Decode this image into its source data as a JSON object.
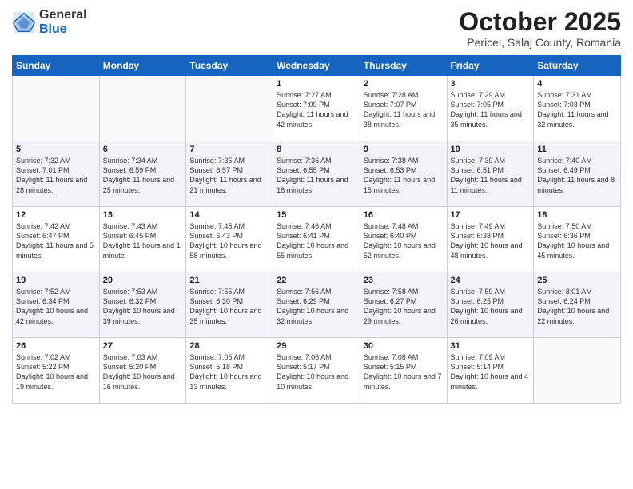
{
  "header": {
    "logo_general": "General",
    "logo_blue": "Blue",
    "month_title": "October 2025",
    "location": "Pericei, Salaj County, Romania"
  },
  "weekdays": [
    "Sunday",
    "Monday",
    "Tuesday",
    "Wednesday",
    "Thursday",
    "Friday",
    "Saturday"
  ],
  "weeks": [
    [
      {
        "empty": true
      },
      {
        "empty": true
      },
      {
        "empty": true
      },
      {
        "day": 1,
        "sunrise": "7:27 AM",
        "sunset": "7:09 PM",
        "daylight": "11 hours and 42 minutes."
      },
      {
        "day": 2,
        "sunrise": "7:28 AM",
        "sunset": "7:07 PM",
        "daylight": "11 hours and 38 minutes."
      },
      {
        "day": 3,
        "sunrise": "7:29 AM",
        "sunset": "7:05 PM",
        "daylight": "11 hours and 35 minutes."
      },
      {
        "day": 4,
        "sunrise": "7:31 AM",
        "sunset": "7:03 PM",
        "daylight": "11 hours and 32 minutes."
      }
    ],
    [
      {
        "day": 5,
        "sunrise": "7:32 AM",
        "sunset": "7:01 PM",
        "daylight": "11 hours and 28 minutes."
      },
      {
        "day": 6,
        "sunrise": "7:34 AM",
        "sunset": "6:59 PM",
        "daylight": "11 hours and 25 minutes."
      },
      {
        "day": 7,
        "sunrise": "7:35 AM",
        "sunset": "6:57 PM",
        "daylight": "11 hours and 21 minutes."
      },
      {
        "day": 8,
        "sunrise": "7:36 AM",
        "sunset": "6:55 PM",
        "daylight": "11 hours and 18 minutes."
      },
      {
        "day": 9,
        "sunrise": "7:38 AM",
        "sunset": "6:53 PM",
        "daylight": "11 hours and 15 minutes."
      },
      {
        "day": 10,
        "sunrise": "7:39 AM",
        "sunset": "6:51 PM",
        "daylight": "11 hours and 11 minutes."
      },
      {
        "day": 11,
        "sunrise": "7:40 AM",
        "sunset": "6:49 PM",
        "daylight": "11 hours and 8 minutes."
      }
    ],
    [
      {
        "day": 12,
        "sunrise": "7:42 AM",
        "sunset": "6:47 PM",
        "daylight": "11 hours and 5 minutes."
      },
      {
        "day": 13,
        "sunrise": "7:43 AM",
        "sunset": "6:45 PM",
        "daylight": "11 hours and 1 minute."
      },
      {
        "day": 14,
        "sunrise": "7:45 AM",
        "sunset": "6:43 PM",
        "daylight": "10 hours and 58 minutes."
      },
      {
        "day": 15,
        "sunrise": "7:46 AM",
        "sunset": "6:41 PM",
        "daylight": "10 hours and 55 minutes."
      },
      {
        "day": 16,
        "sunrise": "7:48 AM",
        "sunset": "6:40 PM",
        "daylight": "10 hours and 52 minutes."
      },
      {
        "day": 17,
        "sunrise": "7:49 AM",
        "sunset": "6:38 PM",
        "daylight": "10 hours and 48 minutes."
      },
      {
        "day": 18,
        "sunrise": "7:50 AM",
        "sunset": "6:36 PM",
        "daylight": "10 hours and 45 minutes."
      }
    ],
    [
      {
        "day": 19,
        "sunrise": "7:52 AM",
        "sunset": "6:34 PM",
        "daylight": "10 hours and 42 minutes."
      },
      {
        "day": 20,
        "sunrise": "7:53 AM",
        "sunset": "6:32 PM",
        "daylight": "10 hours and 39 minutes."
      },
      {
        "day": 21,
        "sunrise": "7:55 AM",
        "sunset": "6:30 PM",
        "daylight": "10 hours and 35 minutes."
      },
      {
        "day": 22,
        "sunrise": "7:56 AM",
        "sunset": "6:29 PM",
        "daylight": "10 hours and 32 minutes."
      },
      {
        "day": 23,
        "sunrise": "7:58 AM",
        "sunset": "6:27 PM",
        "daylight": "10 hours and 29 minutes."
      },
      {
        "day": 24,
        "sunrise": "7:59 AM",
        "sunset": "6:25 PM",
        "daylight": "10 hours and 26 minutes."
      },
      {
        "day": 25,
        "sunrise": "8:01 AM",
        "sunset": "6:24 PM",
        "daylight": "10 hours and 22 minutes."
      }
    ],
    [
      {
        "day": 26,
        "sunrise": "7:02 AM",
        "sunset": "5:22 PM",
        "daylight": "10 hours and 19 minutes."
      },
      {
        "day": 27,
        "sunrise": "7:03 AM",
        "sunset": "5:20 PM",
        "daylight": "10 hours and 16 minutes."
      },
      {
        "day": 28,
        "sunrise": "7:05 AM",
        "sunset": "5:18 PM",
        "daylight": "10 hours and 13 minutes."
      },
      {
        "day": 29,
        "sunrise": "7:06 AM",
        "sunset": "5:17 PM",
        "daylight": "10 hours and 10 minutes."
      },
      {
        "day": 30,
        "sunrise": "7:08 AM",
        "sunset": "5:15 PM",
        "daylight": "10 hours and 7 minutes."
      },
      {
        "day": 31,
        "sunrise": "7:09 AM",
        "sunset": "5:14 PM",
        "daylight": "10 hours and 4 minutes."
      },
      {
        "empty": true
      }
    ]
  ],
  "labels": {
    "sunrise": "Sunrise:",
    "sunset": "Sunset:",
    "daylight": "Daylight:"
  }
}
